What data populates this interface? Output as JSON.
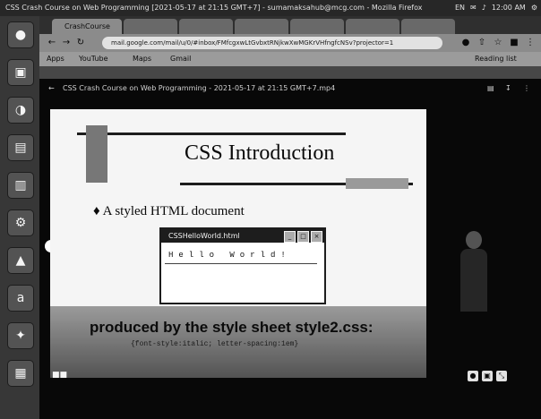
{
  "os": {
    "window_title": "CSS Crash Course on Web Programming [2021-05-17 at 21:15 GMT+7] - sumamaksahub@mcg.com - Mozilla Firefox",
    "status": [
      "EN",
      "✉",
      "♪",
      "12:00 AM",
      "⚙"
    ]
  },
  "launcher": [
    "●",
    "▣",
    "◑",
    "▤",
    "▥",
    "⚙",
    "▲",
    "a",
    "✦",
    "▦"
  ],
  "browser": {
    "tabs": [
      "CrashCourse",
      "",
      "",
      "",
      "",
      "",
      ""
    ],
    "url": "mail.google.com/mail/u/0/#inbox/FMfcgxwLtGvbxtRNjkwXwMGKrVHfngfcNSv?projector=1",
    "bookmarks": [
      "Apps",
      "YouTube",
      "Maps",
      "Gmail"
    ],
    "reading_list": "Reading list"
  },
  "video": {
    "header_title": "CSS Crash Course on Web Programming - 2021-05-17 at 21:15 GMT+7.mp4",
    "slide": {
      "title": "CSS Introduction",
      "bullet": "A styled HTML document",
      "window_title": "CSSHelloWorld.html",
      "window_text": "Hello World!",
      "caption": "produced by the style sheet style2.css:",
      "code": "{font-style:italic; letter-spacing:1em}"
    },
    "controls": [
      "■■",
      "●",
      "▣",
      "⤡"
    ]
  }
}
